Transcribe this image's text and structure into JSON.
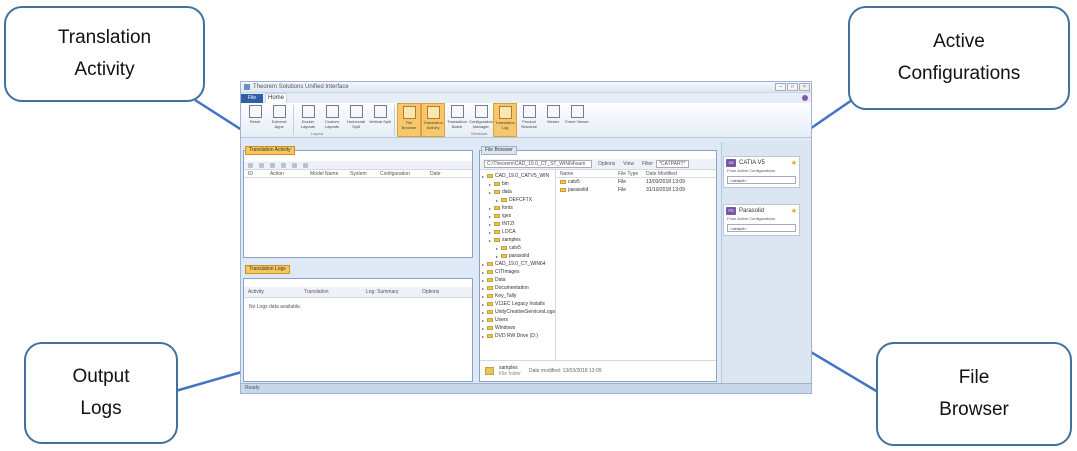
{
  "callouts": {
    "translation_line1": "Translation",
    "translation_line2": "Activity",
    "active_line1": "Active",
    "active_line2": "Configurations",
    "output_line1": "Output",
    "output_line2": "Logs",
    "file_line1": "File",
    "file_line2": "Browser"
  },
  "app": {
    "title": "Theorem Solutions Unified Interface",
    "tabs": {
      "file": "File",
      "home": "Home"
    },
    "ribbon": [
      {
        "label": "Reset",
        "active": false
      },
      {
        "label": "External Apps",
        "active": false
      },
      {
        "label": "Docker Layouts",
        "active": false
      },
      {
        "label": "Custom Layouts",
        "active": false
      },
      {
        "label": "Horizontal Split",
        "active": false
      },
      {
        "label": "Vertical Split",
        "active": false
      },
      {
        "label": "File Browser",
        "active": true
      },
      {
        "label": "Translation Activity",
        "active": true
      },
      {
        "label": "Translation Batch",
        "active": false
      },
      {
        "label": "Configuration Manager",
        "active": false
      },
      {
        "label": "Translation Log",
        "active": true
      },
      {
        "label": "Product Structure",
        "active": false
      },
      {
        "label": "Viewer",
        "active": false
      },
      {
        "label": "Event Viewer",
        "active": false
      }
    ],
    "ribbon_groups": {
      "g1": "Layout",
      "g2": "Windows"
    },
    "activity": {
      "tab": "Translation Activity",
      "columns": [
        "ID",
        "Action",
        "Model Name",
        "System",
        "Configuration",
        "Date"
      ]
    },
    "logs": {
      "tab": "Translation Logs",
      "filters": [
        "Activity",
        "Translation",
        "Log: Summary",
        "Options"
      ],
      "message": "No Logs data available."
    },
    "browser": {
      "tab": "File Browser",
      "path": "C:\\Theorem\\CAD_19.0_CT_ST_WIN64\\sam",
      "options": "Options",
      "view": "View",
      "filter_label": "Filter",
      "filter_value": "*CATPART*",
      "tree": [
        {
          "label": "CAD_19.0_CATV5_WIN",
          "depth": 0
        },
        {
          "label": "bin",
          "depth": 1
        },
        {
          "label": "data",
          "depth": 1
        },
        {
          "label": "DEFCFTX",
          "depth": 2
        },
        {
          "label": "fonts",
          "depth": 1
        },
        {
          "label": "iges",
          "depth": 1
        },
        {
          "label": "INTZI",
          "depth": 1
        },
        {
          "label": "LOCA",
          "depth": 1
        },
        {
          "label": "samples",
          "depth": 1
        },
        {
          "label": "catv5",
          "depth": 2
        },
        {
          "label": "parasolid",
          "depth": 2
        },
        {
          "label": "CAD_19.0_CT_WIN64",
          "depth": 0
        },
        {
          "label": "CITImages",
          "depth": 0
        },
        {
          "label": "Data",
          "depth": 0
        },
        {
          "label": "Documentation",
          "depth": 0
        },
        {
          "label": "Key_Tally",
          "depth": 0
        },
        {
          "label": "V11EC Legacy Installs",
          "depth": 0
        },
        {
          "label": "UnityCreativeServicesLogs",
          "depth": 0
        },
        {
          "label": "Users",
          "depth": 0
        },
        {
          "label": "Windows",
          "depth": 0
        },
        {
          "label": "DVD RW Drive (D:)",
          "depth": 0
        }
      ],
      "columns": [
        "Name",
        "File Type",
        "Date Modified"
      ],
      "files": [
        {
          "name": "catv5",
          "type": "File",
          "date": "13/03/2018 13:09"
        },
        {
          "name": "parasolid",
          "type": "File",
          "date": "31/10/2018 13:09"
        }
      ],
      "footer_name": "samples",
      "footer_meta": "Date modified: 13/03/2018 13:09",
      "footer_type": "File folder"
    },
    "config": {
      "card1_title": "CATIA V5",
      "card1_sub": "From Active Configurations",
      "card1_value": "<default>",
      "card2_title": "Parasolid",
      "card2_sub": "From Active Configurations",
      "card2_value": "<default>"
    },
    "status": "Ready"
  }
}
